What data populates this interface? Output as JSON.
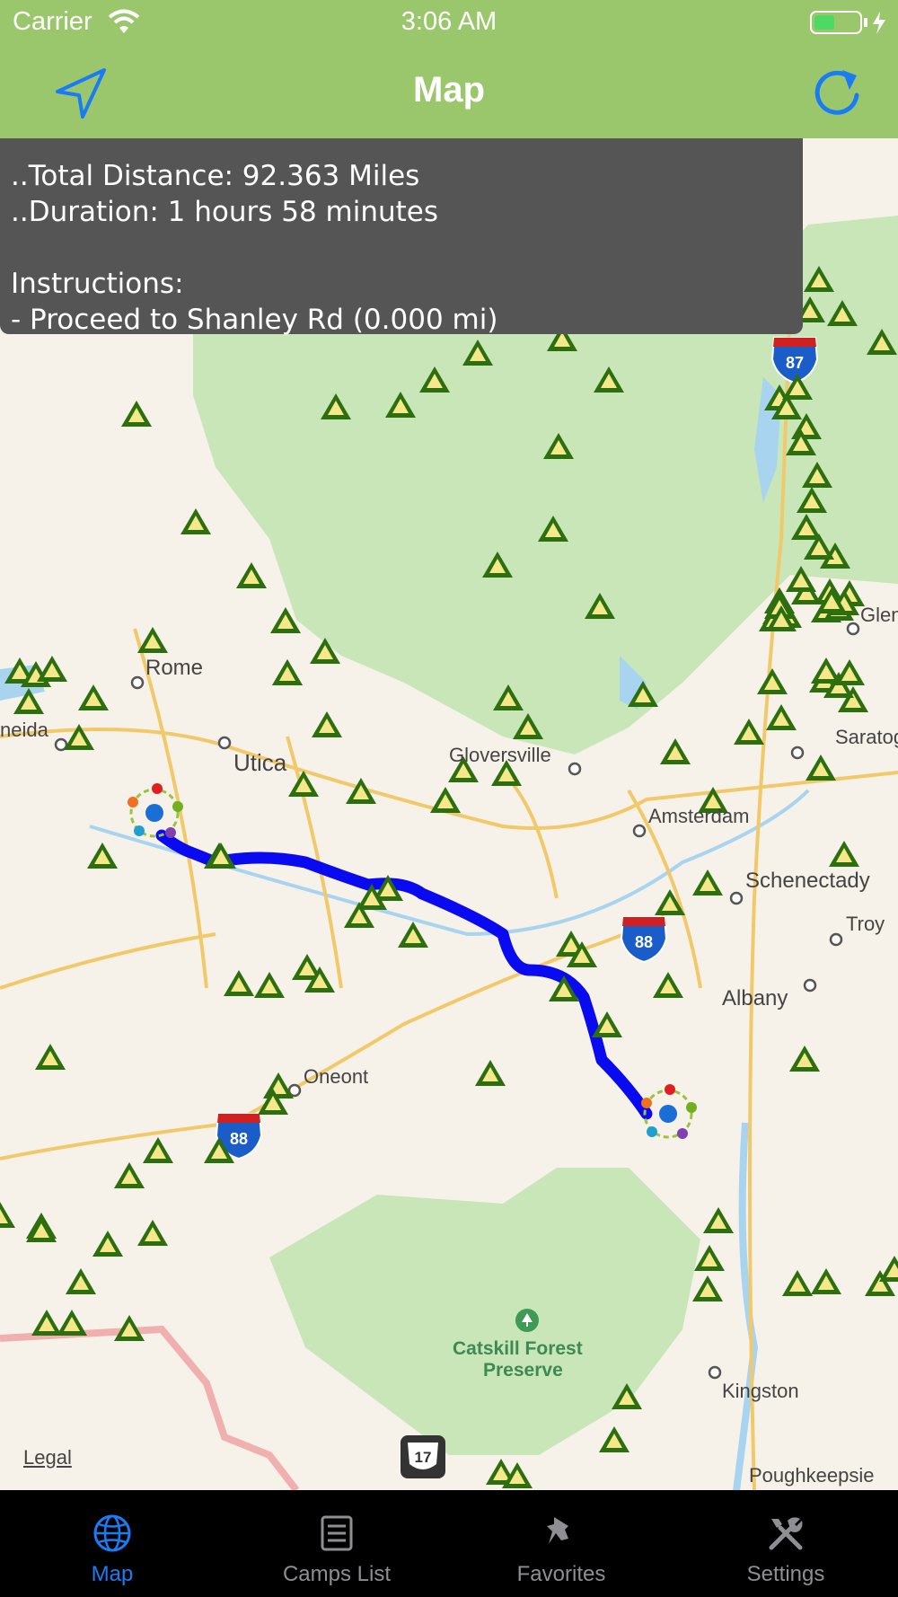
{
  "status_bar": {
    "carrier": "Carrier",
    "time": "3:06 AM"
  },
  "nav_bar": {
    "title": "Map",
    "left_icon": "location-arrow-icon",
    "right_icon": "refresh-icon"
  },
  "info_panel": {
    "line1": "..Total Distance: 92.363 Miles",
    "line2": "..Duration: 1 hours 58 minutes",
    "line3": "Instructions:",
    "line4": "- Proceed to Shanley Rd (0.000 mi)"
  },
  "map": {
    "labels": {
      "rome": "Rome",
      "utica": "Utica",
      "oneida": "neida",
      "gloversville": "Gloversville",
      "amsterdam": "Amsterdam",
      "schenectady": "Schenectady",
      "troy": "Troy",
      "albany": "Albany",
      "saratoga": "Saratoga",
      "glens": "Glen",
      "oneonta": "Oneont",
      "kingston": "Kingston",
      "poughkeepsie": "Poughkeepsie",
      "catskill": "Catskill Forest",
      "catskill2": "Preserve"
    },
    "shields": {
      "i87": "87",
      "i88a": "88",
      "i88b": "88",
      "rt17": "17"
    },
    "legal": "Legal",
    "colors": {
      "route": "#0a0af0",
      "camp_marker": "#2d6e0e",
      "park": "#c8e6b8",
      "water": "#a8d4f0"
    }
  },
  "tab_bar": {
    "tabs": [
      {
        "label": "Map",
        "icon": "globe-icon",
        "active": true
      },
      {
        "label": "Camps List",
        "icon": "list-icon",
        "active": false
      },
      {
        "label": "Favorites",
        "icon": "pushpin-icon",
        "active": false
      },
      {
        "label": "Settings",
        "icon": "tools-icon",
        "active": false
      }
    ]
  }
}
